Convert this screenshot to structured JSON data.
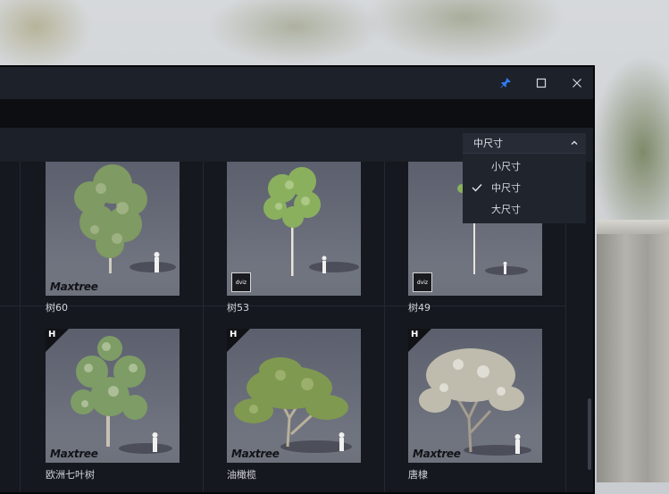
{
  "dropdown": {
    "selected": "中尺寸",
    "options": [
      {
        "label": "小尺寸",
        "checked": false
      },
      {
        "label": "中尺寸",
        "checked": true
      },
      {
        "label": "大尺寸",
        "checked": false
      }
    ]
  },
  "cards": [
    {
      "name": "树60",
      "badge": "Maxtree",
      "corner": ""
    },
    {
      "name": "树53",
      "badge": "dviz",
      "corner": ""
    },
    {
      "name": "树49",
      "badge": "dviz",
      "corner": ""
    },
    {
      "name": "欧洲七叶树",
      "badge": "Maxtree",
      "corner": "H"
    },
    {
      "name": "油橄榄",
      "badge": "Maxtree",
      "corner": "H"
    },
    {
      "name": "唐棣",
      "badge": "Maxtree",
      "corner": "H"
    }
  ],
  "icons": {
    "pin": "pin-icon",
    "maximize": "maximize-icon",
    "close": "close-icon",
    "caret": "chevron-up-icon",
    "check": "check-icon"
  },
  "colors": {
    "accent": "#2f7cf6",
    "panel": "#14171c",
    "titlebar": "#1d2129"
  }
}
